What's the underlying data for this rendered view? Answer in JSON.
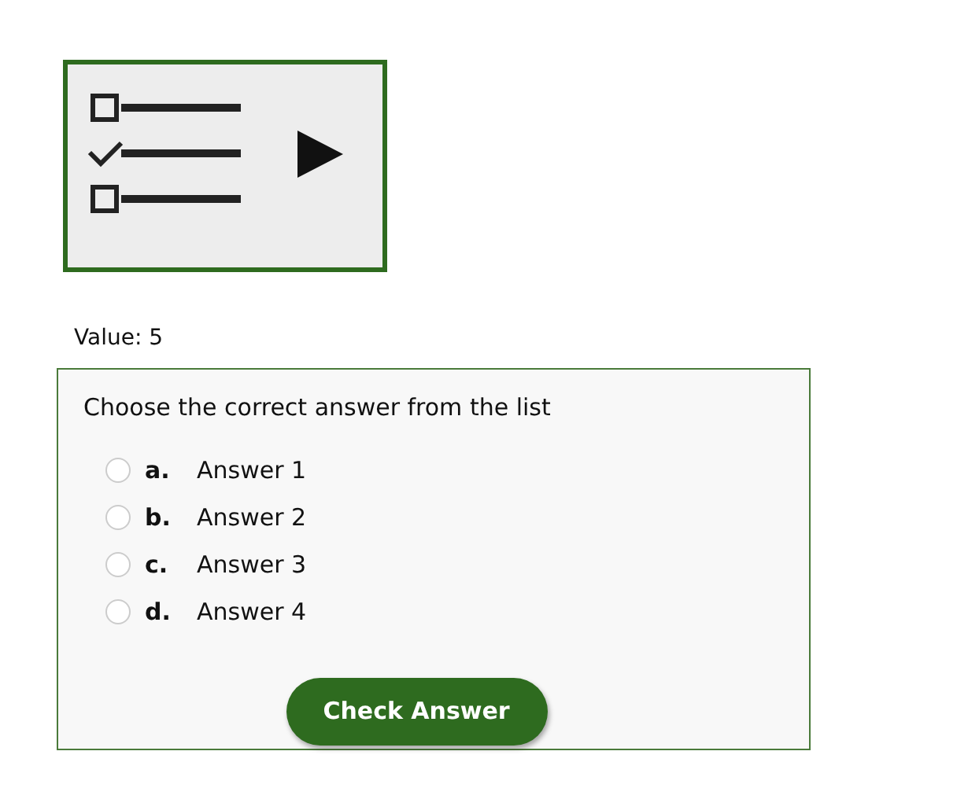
{
  "value_label": "Value: 5",
  "question": {
    "prompt": "Choose the correct answer from the list",
    "options": [
      {
        "letter": "a.",
        "text": "Answer 1",
        "selected": false
      },
      {
        "letter": "b.",
        "text": "Answer 2",
        "selected": false
      },
      {
        "letter": "c.",
        "text": "Answer 3",
        "selected": false
      },
      {
        "letter": "d.",
        "text": "Answer 4",
        "selected": false
      }
    ],
    "button": "Check Answer"
  }
}
